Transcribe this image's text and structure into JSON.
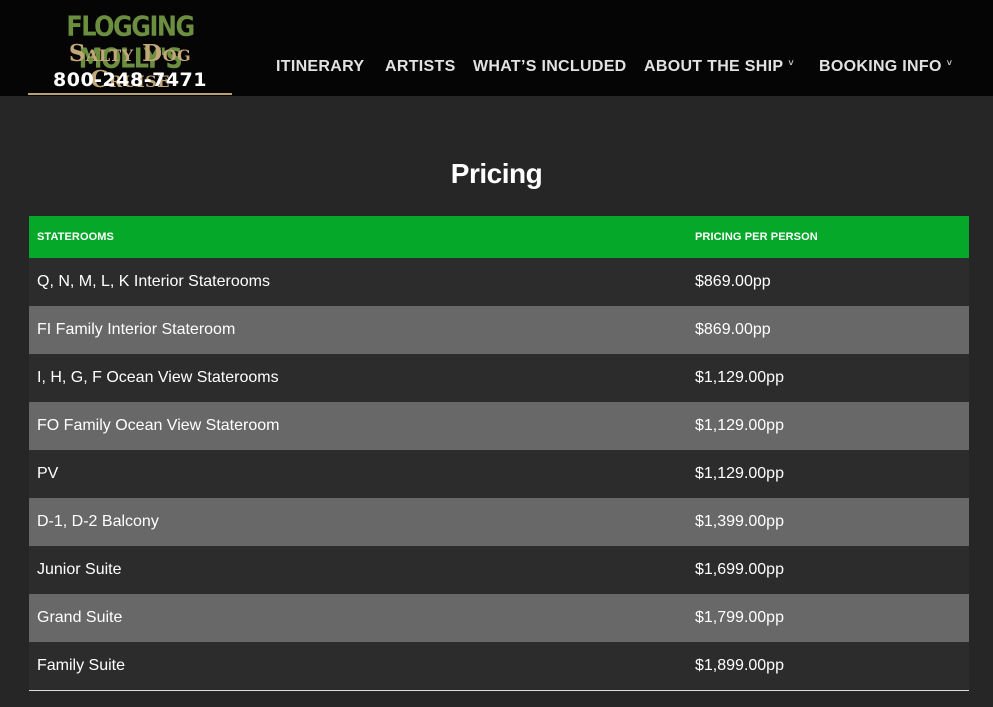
{
  "header": {
    "logo": {
      "line1": "FLOGGING MOLLY'S",
      "line2": "Salty Dog Cruise",
      "phone": "800-248-7471"
    },
    "nav": [
      {
        "label": "ITINERARY",
        "has_dropdown": false
      },
      {
        "label": "ARTISTS",
        "has_dropdown": false
      },
      {
        "label": "WHAT’S INCLUDED",
        "has_dropdown": false
      },
      {
        "label": "ABOUT THE SHIP",
        "has_dropdown": true
      },
      {
        "label": "BOOKING INFO",
        "has_dropdown": true
      }
    ],
    "chevron_glyph": "˅"
  },
  "main": {
    "title": "Pricing",
    "table": {
      "headers": [
        "STATEROOMS",
        "PRICING PER PERSON"
      ],
      "rows": [
        {
          "stateroom": "Q, N, M, L, K Interior Staterooms",
          "price": "$869.00pp"
        },
        {
          "stateroom": "FI Family Interior Stateroom",
          "price": "$869.00pp"
        },
        {
          "stateroom": "I, H, G, F Ocean View Staterooms",
          "price": "$1,129.00pp"
        },
        {
          "stateroom": "FO Family Ocean View Stateroom",
          "price": "$1,129.00pp"
        },
        {
          "stateroom": "PV",
          "price": "$1,129.00pp"
        },
        {
          "stateroom": "D-1, D-2 Balcony",
          "price": "$1,399.00pp"
        },
        {
          "stateroom": "Junior Suite",
          "price": "$1,699.00pp"
        },
        {
          "stateroom": "Grand Suite",
          "price": "$1,799.00pp"
        },
        {
          "stateroom": "Family Suite",
          "price": "$1,899.00pp"
        }
      ]
    }
  },
  "colors": {
    "header_bg": "#050505",
    "page_bg": "#262626",
    "table_header": "#05a829",
    "row_dark": "#2c2c2c",
    "row_light": "#686868",
    "logo_green": "#6c8f3f",
    "logo_tan": "#c2a878"
  }
}
